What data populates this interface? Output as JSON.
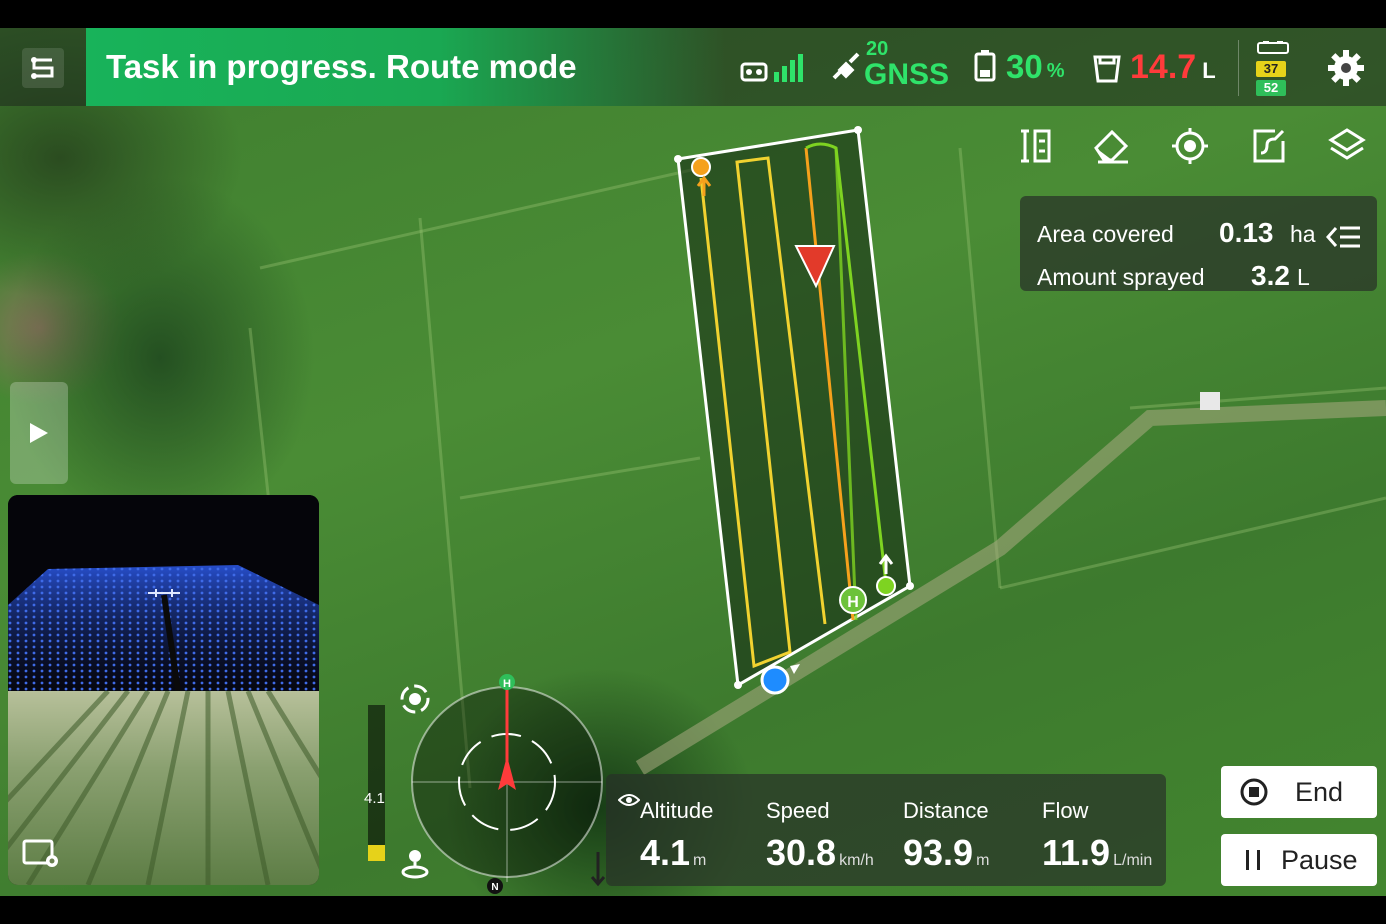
{
  "status_bar": {
    "task_text": "Task in progress. Route mode",
    "gnss_count": "20",
    "gnss_label": "GNSS",
    "battery_value": "30",
    "battery_unit": "%",
    "tank_value": "14.7",
    "tank_unit": "L",
    "battery_cell_top": "37",
    "battery_cell_bottom": "52"
  },
  "toolbar": {
    "items": [
      "route-params-icon",
      "eraser-icon",
      "locate-icon",
      "edit-route-icon",
      "layers-icon"
    ]
  },
  "info_panel": {
    "area_label": "Area covered",
    "area_value": "0.13",
    "area_unit": "ha",
    "sprayed_label": "Amount sprayed",
    "sprayed_value": "3.2",
    "sprayed_unit": "L"
  },
  "altitude_gauge": {
    "label": "4.1",
    "level_fraction": 0.1
  },
  "compass": {
    "home_marker": "H",
    "north_marker": "N"
  },
  "telemetry": {
    "altitude_label": "Altitude",
    "altitude_value": "4.1",
    "altitude_unit": "m",
    "speed_label": "Speed",
    "speed_value": "30.8",
    "speed_unit": "km/h",
    "distance_label": "Distance",
    "distance_value": "93.9",
    "distance_unit": "m",
    "flow_label": "Flow",
    "flow_value": "11.9",
    "flow_unit": "L/min"
  },
  "actions": {
    "end_label": "End",
    "pause_label": "Pause"
  },
  "map": {
    "home_marker": "H"
  },
  "colors": {
    "accent_green": "#2fe36a",
    "banner_green": "#1aa852",
    "warning_red": "#ff3b3b",
    "route_yellow": "#f1d230",
    "route_orange": "#f5a11c",
    "route_green": "#7ed321"
  }
}
